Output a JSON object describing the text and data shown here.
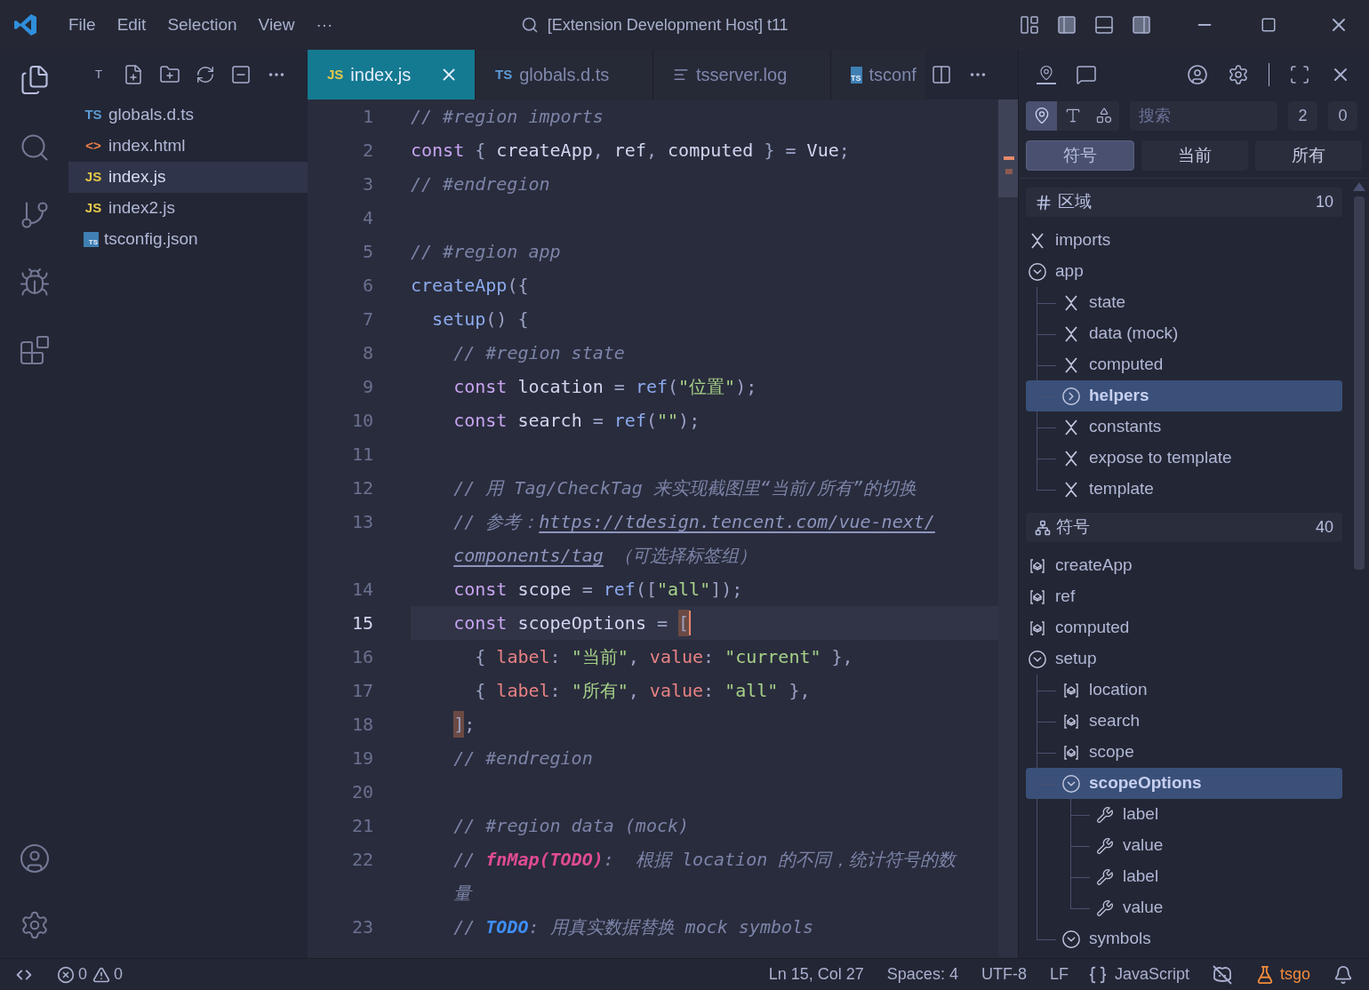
{
  "title_bar": {
    "menus": [
      "File",
      "Edit",
      "Selection",
      "View",
      "···"
    ],
    "title": "[Extension Development Host] t11"
  },
  "activity_bar": {
    "items": [
      {
        "kind": "files",
        "selected": true
      },
      {
        "kind": "search",
        "selected": false
      },
      {
        "kind": "source-control",
        "selected": false
      },
      {
        "kind": "run",
        "selected": false
      },
      {
        "kind": "extensions",
        "selected": false
      }
    ]
  },
  "explorer": {
    "title": "T",
    "files": [
      {
        "name": "globals.d.ts",
        "badge": "TS",
        "color": "#5b9bd5",
        "boxed": false,
        "selected": false
      },
      {
        "name": "index.html",
        "badge": "<>",
        "color": "#e8804a",
        "boxed": false,
        "selected": false
      },
      {
        "name": "index.js",
        "badge": "JS",
        "color": "#e5c84a",
        "boxed": false,
        "selected": true
      },
      {
        "name": "index2.js",
        "badge": "JS",
        "color": "#e5c84a",
        "boxed": false,
        "selected": false
      },
      {
        "name": "tsconfig.json",
        "badge": "TS",
        "color": "#3f7fb3",
        "boxed": true,
        "selected": false
      }
    ]
  },
  "tabs": [
    {
      "label": "index.js",
      "badge": "JS",
      "kind": "badge",
      "selected": true
    },
    {
      "label": "globals.d.ts",
      "badge": "TS",
      "kind": "badge",
      "selected": false
    },
    {
      "label": "tsserver.log",
      "kind": "log",
      "selected": false
    },
    {
      "label": "tsconf",
      "badge": "TS",
      "kind": "boxed",
      "selected": false
    }
  ],
  "code": [
    {
      "number": "1",
      "tokens": [
        {
          "kind": "comment",
          "text": "// #region imports"
        }
      ]
    },
    {
      "number": "2",
      "tokens": [
        {
          "kind": "keyword",
          "text": "const"
        },
        {
          "kind": "punct",
          "text": " { "
        },
        {
          "kind": "ident",
          "text": "createApp"
        },
        {
          "kind": "punct",
          "text": ", "
        },
        {
          "kind": "ident",
          "text": "ref"
        },
        {
          "kind": "punct",
          "text": ", "
        },
        {
          "kind": "ident",
          "text": "computed"
        },
        {
          "kind": "punct",
          "text": " } = "
        },
        {
          "kind": "ident",
          "text": "Vue"
        },
        {
          "kind": "punct",
          "text": ";"
        }
      ]
    },
    {
      "number": "3",
      "tokens": [
        {
          "kind": "comment",
          "text": "// #endregion"
        }
      ]
    },
    {
      "number": "4"
    },
    {
      "number": "5",
      "tokens": [
        {
          "kind": "comment",
          "text": "// #region app"
        }
      ]
    },
    {
      "number": "6",
      "tokens": [
        {
          "kind": "function",
          "text": "createApp"
        },
        {
          "kind": "punct",
          "text": "({"
        }
      ]
    },
    {
      "number": "7",
      "tokens": [
        {
          "kind": "function",
          "text": "  setup"
        },
        {
          "kind": "punct",
          "text": "() {"
        }
      ]
    },
    {
      "number": "8",
      "tokens": [
        {
          "kind": "comment",
          "text": "    // #region state"
        }
      ]
    },
    {
      "number": "9",
      "tokens": [
        {
          "kind": "keyword",
          "text": "    const"
        },
        {
          "kind": "ident",
          "text": " location "
        },
        {
          "kind": "punct",
          "text": "= "
        },
        {
          "kind": "function",
          "text": "ref"
        },
        {
          "kind": "punct",
          "text": "("
        },
        {
          "kind": "string",
          "text": "\"位置\""
        },
        {
          "kind": "punct",
          "text": ");"
        }
      ]
    },
    {
      "number": "10",
      "tokens": [
        {
          "kind": "keyword",
          "text": "    const"
        },
        {
          "kind": "ident",
          "text": " search "
        },
        {
          "kind": "punct",
          "text": "= "
        },
        {
          "kind": "function",
          "text": "ref"
        },
        {
          "kind": "punct",
          "text": "("
        },
        {
          "kind": "string",
          "text": "\"\""
        },
        {
          "kind": "punct",
          "text": ");"
        }
      ]
    },
    {
      "number": "11"
    },
    {
      "number": "12",
      "tokens": [
        {
          "kind": "comment",
          "text": "    // 用 Tag/CheckTag 来实现截图里“当前/所有”的切换"
        }
      ]
    },
    {
      "number": "13",
      "tokens": [
        {
          "kind": "comment",
          "text": "    // 参考："
        },
        {
          "kind": "link",
          "text": "https://tdesign.tencent.com/vue-next/"
        }
      ]
    },
    {
      "tokens": [
        {
          "kind": "link",
          "text": "components/tag"
        },
        {
          "kind": "comment",
          "text": " （可选择标签组）"
        }
      ]
    },
    {
      "number": "14",
      "tokens": [
        {
          "kind": "keyword",
          "text": "    const"
        },
        {
          "kind": "ident",
          "text": " scope "
        },
        {
          "kind": "punct",
          "text": "= "
        },
        {
          "kind": "function",
          "text": "ref"
        },
        {
          "kind": "punct",
          "text": "(["
        },
        {
          "kind": "string",
          "text": "\"all\""
        },
        {
          "kind": "punct",
          "text": "]);"
        }
      ]
    },
    {
      "number": "15",
      "current": true,
      "tokens": [
        {
          "kind": "keyword",
          "text": "    const"
        },
        {
          "kind": "ident",
          "text": " scopeOptions "
        },
        {
          "kind": "punct",
          "text": "= "
        },
        {
          "kind": "bracket",
          "text": "["
        }
      ]
    },
    {
      "number": "16",
      "tokens": [
        {
          "kind": "punct",
          "text": "      { "
        },
        {
          "kind": "property",
          "text": "label"
        },
        {
          "kind": "punct",
          "text": ": "
        },
        {
          "kind": "string",
          "text": "\"当前\""
        },
        {
          "kind": "punct",
          "text": ", "
        },
        {
          "kind": "property",
          "text": "value"
        },
        {
          "kind": "punct",
          "text": ": "
        },
        {
          "kind": "string",
          "text": "\"current\""
        },
        {
          "kind": "punct",
          "text": " },"
        }
      ]
    },
    {
      "number": "17",
      "tokens": [
        {
          "kind": "punct",
          "text": "      { "
        },
        {
          "kind": "property",
          "text": "label"
        },
        {
          "kind": "punct",
          "text": ": "
        },
        {
          "kind": "string",
          "text": "\"所有\""
        },
        {
          "kind": "punct",
          "text": ", "
        },
        {
          "kind": "property",
          "text": "value"
        },
        {
          "kind": "punct",
          "text": ": "
        },
        {
          "kind": "string",
          "text": "\"all\""
        },
        {
          "kind": "punct",
          "text": " },"
        }
      ]
    },
    {
      "number": "18",
      "tokens": [
        {
          "kind": "bracket",
          "text": "    ]"
        },
        {
          "kind": "punct",
          "text": ";"
        }
      ]
    },
    {
      "number": "19",
      "tokens": [
        {
          "kind": "comment",
          "text": "    // #endregion"
        }
      ]
    },
    {
      "number": "20"
    },
    {
      "number": "21",
      "tokens": [
        {
          "kind": "comment",
          "text": "    // #region data (mock)"
        }
      ]
    },
    {
      "number": "22",
      "tokens": [
        {
          "kind": "comment",
          "text": "    // "
        },
        {
          "kind": "fixme",
          "text": "fnMap(TODO)"
        },
        {
          "kind": "comment",
          "text": ":  根据 location 的不同，统计符号的数"
        }
      ]
    },
    {
      "tokens": [
        {
          "kind": "comment",
          "text": "量"
        }
      ]
    },
    {
      "number": "23",
      "tokens": [
        {
          "kind": "comment",
          "text": "    // "
        },
        {
          "kind": "todo",
          "text": "TODO"
        },
        {
          "kind": "comment",
          "text": ": 用真实数据替换 mock symbols"
        }
      ]
    }
  ],
  "outline": {
    "filters": [
      {
        "kind": "pin",
        "selected": true
      },
      {
        "kind": "text",
        "selected": false
      },
      {
        "kind": "shapes",
        "selected": false
      }
    ],
    "search": {
      "placeholder": "搜索"
    },
    "counters": [
      "2",
      "0"
    ],
    "scopes": [
      {
        "label": "符号",
        "selected": true
      },
      {
        "label": "当前",
        "selected": false
      },
      {
        "label": "所有",
        "selected": false
      }
    ],
    "sections": [
      {
        "kind": "regions",
        "title": "区域",
        "count": "10",
        "items": [
          {
            "label": "imports",
            "kind": "region",
            "selected": false
          },
          {
            "label": "app",
            "kind": "group",
            "expanded": true,
            "selected": false,
            "children": [
              {
                "label": "state",
                "kind": "region",
                "selected": false
              },
              {
                "label": "data (mock)",
                "kind": "region",
                "selected": false
              },
              {
                "label": "computed",
                "kind": "region",
                "selected": false
              },
              {
                "label": "helpers",
                "kind": "group",
                "expanded": false,
                "selected": true
              },
              {
                "label": "constants",
                "kind": "region",
                "selected": false
              },
              {
                "label": "expose to template",
                "kind": "region",
                "selected": false
              },
              {
                "label": "template",
                "kind": "region",
                "selected": false
              }
            ]
          }
        ]
      },
      {
        "kind": "symbols",
        "title": "符号",
        "count": "40",
        "items": [
          {
            "label": "createApp",
            "kind": "variable",
            "selected": false
          },
          {
            "label": "ref",
            "kind": "variable",
            "selected": false
          },
          {
            "label": "computed",
            "kind": "variable",
            "selected": false
          },
          {
            "label": "setup",
            "kind": "group",
            "expanded": true,
            "selected": false,
            "children": [
              {
                "label": "location",
                "kind": "variable",
                "selected": false
              },
              {
                "label": "search",
                "kind": "variable",
                "selected": false
              },
              {
                "label": "scope",
                "kind": "variable",
                "selected": false
              },
              {
                "label": "scopeOptions",
                "kind": "group",
                "expanded": true,
                "selected": true,
                "children": [
                  {
                    "label": "label",
                    "kind": "property",
                    "selected": false
                  },
                  {
                    "label": "value",
                    "kind": "property",
                    "selected": false
                  },
                  {
                    "label": "label",
                    "kind": "property",
                    "selected": false
                  },
                  {
                    "label": "value",
                    "kind": "property",
                    "selected": false
                  }
                ]
              },
              {
                "label": "symbols",
                "kind": "group",
                "expanded": true,
                "selected": false
              }
            ]
          }
        ]
      }
    ]
  },
  "status_bar": {
    "errors": "0",
    "warnings": "0",
    "position": "Ln 15, Col 27",
    "indent": "Spaces: 4",
    "encoding": "UTF-8",
    "eol": "LF",
    "language": "JavaScript",
    "tool": "tsgo"
  }
}
